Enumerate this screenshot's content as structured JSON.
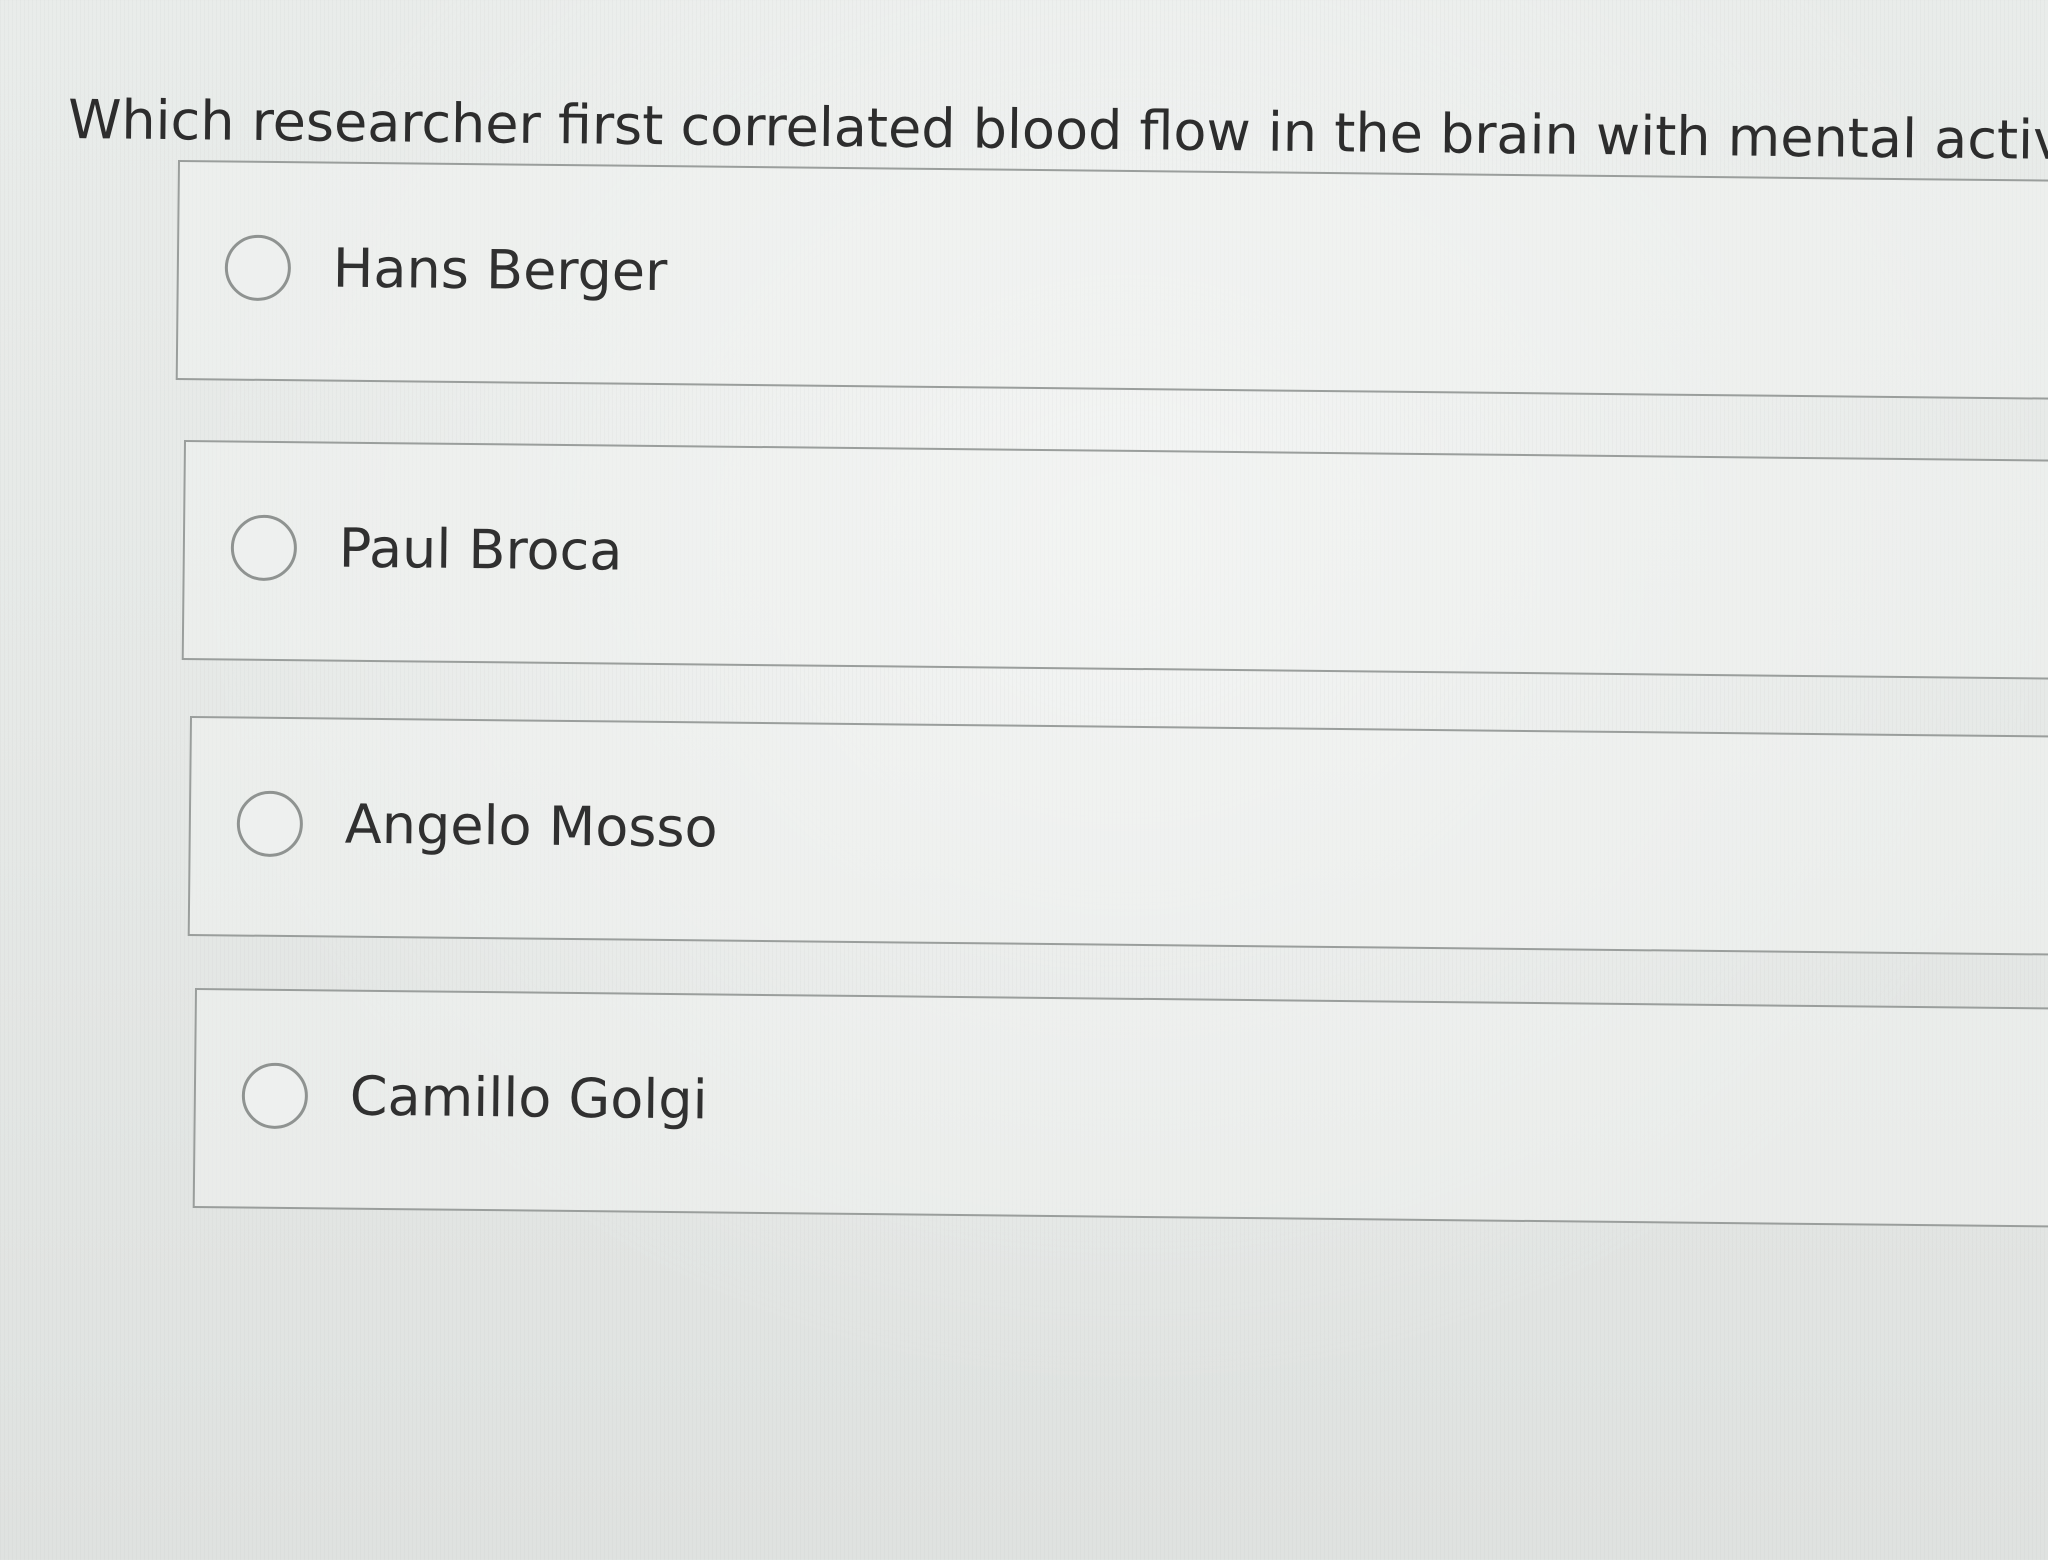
{
  "question": {
    "text": "Which researcher first correlated blood flow in the brain with mental activity?"
  },
  "options": [
    {
      "label": "Hans Berger",
      "selected": false
    },
    {
      "label": "Paul Broca",
      "selected": false
    },
    {
      "label": "Angelo Mosso",
      "selected": false
    },
    {
      "label": "Camillo Golgi",
      "selected": false
    }
  ]
}
